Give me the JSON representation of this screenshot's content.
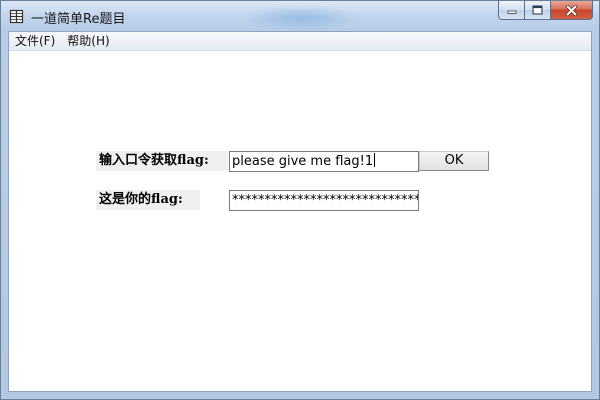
{
  "window": {
    "title": "一道简单Re题目",
    "app_icon": "grid-icon",
    "caption_buttons": [
      "minimize-icon",
      "maximize-icon",
      "close-icon"
    ]
  },
  "menu": {
    "items": [
      {
        "label": "文件(F)"
      },
      {
        "label": "帮助(H)"
      }
    ]
  },
  "form": {
    "password_label": "输入口令获取flag:",
    "password_value": "please give me flag!1",
    "ok_label": "OK",
    "flag_label": "这是你的flag:",
    "flag_value": "********************************"
  }
}
